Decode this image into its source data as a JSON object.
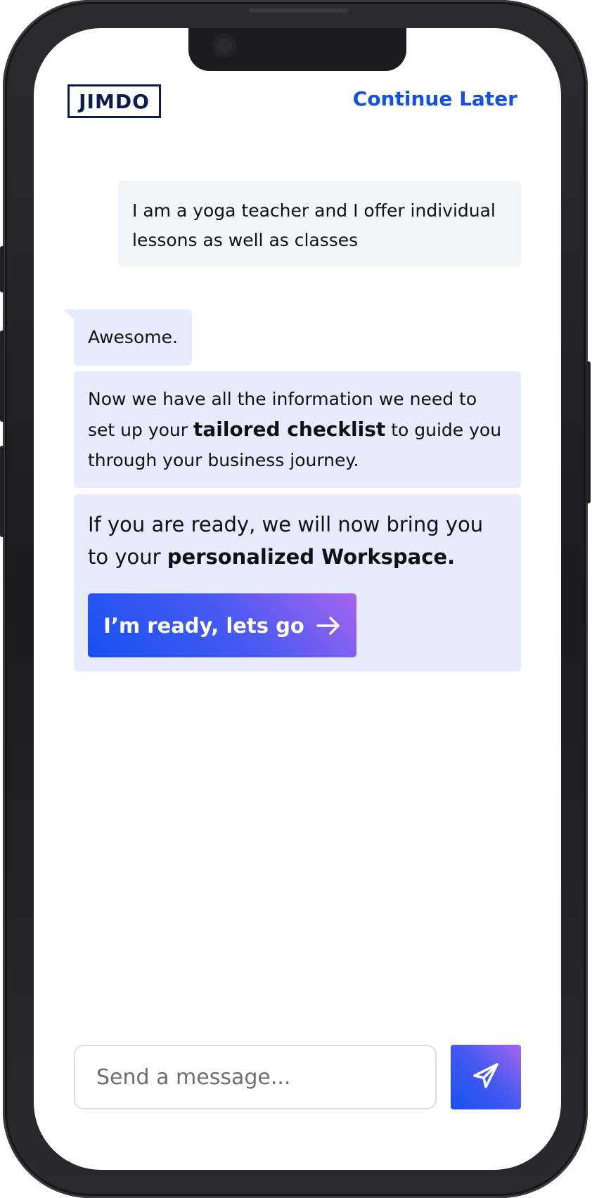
{
  "header": {
    "logo_text": "JIMDO",
    "continue_later": "Continue Later"
  },
  "messages": {
    "user": "I am a yoga teacher and I offer individual lessons as well as classes",
    "bot1": "Awesome.",
    "bot2": {
      "before": "Now we have all the information we need to set up your ",
      "bold": "tailored checklist",
      "after": " to guide you through your business journey."
    },
    "bot3": {
      "before": "If you are ready, we will now bring you to your ",
      "bold": "personalized Workspace."
    },
    "cta_label": "I’m ready, lets go"
  },
  "composer": {
    "placeholder": "Send a message...",
    "value": ""
  },
  "icons": {
    "cta": "arrow-right-icon",
    "send": "paper-plane-icon"
  },
  "colors": {
    "brand_navy": "#0d1b4d",
    "link_blue": "#1450e6",
    "user_bubble": "#f3f6f8",
    "bot_bubble": "#e8ebfd",
    "gradient_start": "#1450f0",
    "gradient_end": "#a765ef"
  }
}
